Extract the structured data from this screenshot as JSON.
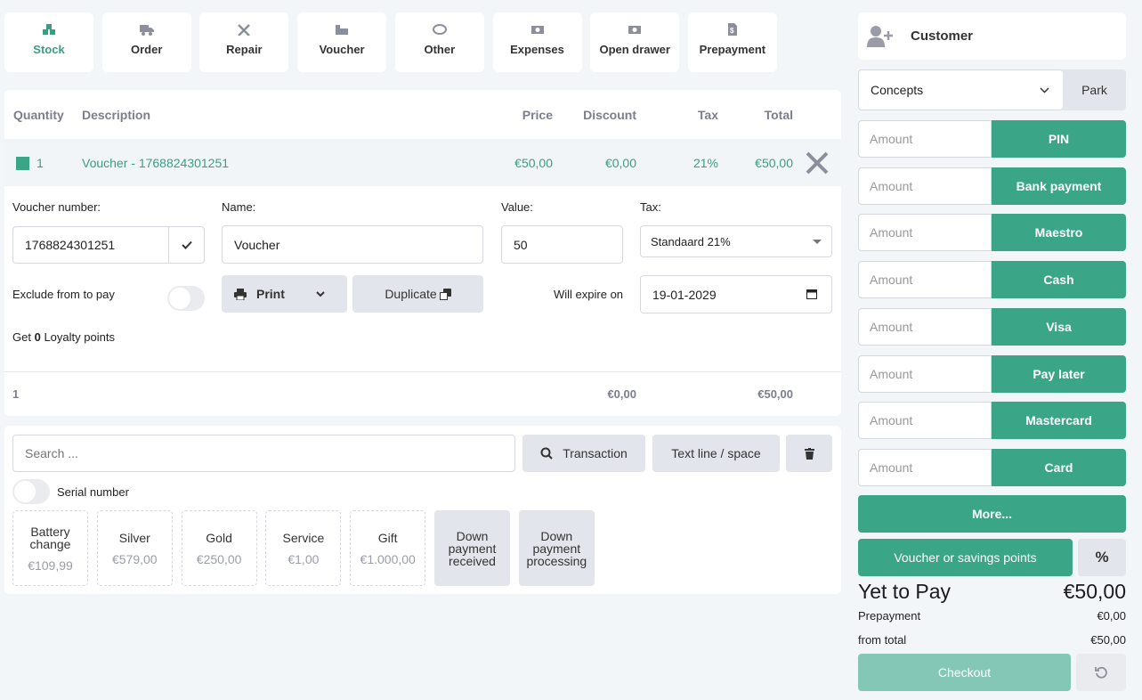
{
  "tabs": [
    {
      "label": "Stock",
      "icon": "boxes-icon"
    },
    {
      "label": "Order",
      "icon": "truck-icon"
    },
    {
      "label": "Repair",
      "icon": "tools-icon"
    },
    {
      "label": "Voucher",
      "icon": "voucher-icon"
    },
    {
      "label": "Other",
      "icon": "ring-icon"
    },
    {
      "label": "Expenses",
      "icon": "money-icon"
    },
    {
      "label": "Open drawer",
      "icon": "cash-drawer-icon"
    },
    {
      "label": "Prepayment",
      "icon": "invoice-icon"
    }
  ],
  "table": {
    "headers": {
      "quantity": "Quantity",
      "description": "Description",
      "price": "Price",
      "discount": "Discount",
      "tax": "Tax",
      "total": "Total"
    },
    "row": {
      "quantity": "1",
      "description": "Voucher - 1768824301251",
      "price": "€50,00",
      "discount": "€0,00",
      "tax": "21%",
      "total": "€50,00"
    },
    "totals": {
      "quantity": "1",
      "discount": "€0,00",
      "total": "€50,00"
    }
  },
  "form": {
    "voucher_label": "Voucher number:",
    "voucher_value": "1768824301251",
    "name_label": "Name:",
    "name_value": "Voucher",
    "value_label": "Value:",
    "value_value": "50",
    "tax_label": "Tax:",
    "tax_value": "Standaard 21%",
    "exclude_label": "Exclude from to pay",
    "print": "Print",
    "duplicate": "Duplicate",
    "expire_label": "Will expire on",
    "expire_value": "19-01-2029",
    "loyalty_pre": "Get",
    "loyalty_points": "0",
    "loyalty_post": "Loyalty points"
  },
  "search": {
    "placeholder": "Search ...",
    "transaction": "Transaction",
    "text_line": "Text line / space",
    "serial": "Serial number"
  },
  "quick": [
    {
      "name": "Battery change",
      "price": "€109,99"
    },
    {
      "name": "Silver",
      "price": "€579,00"
    },
    {
      "name": "Gold",
      "price": "€250,00"
    },
    {
      "name": "Service",
      "price": "€1,00"
    },
    {
      "name": "Gift",
      "price": "€1.000,00"
    },
    {
      "name": "Down payment received"
    },
    {
      "name": "Down payment processing"
    }
  ],
  "right": {
    "customer": "Customer",
    "concepts": "Concepts",
    "park": "Park",
    "amount_placeholder": "Amount",
    "payments": [
      "PIN",
      "Bank payment",
      "Maestro",
      "Cash",
      "Visa",
      "Pay later",
      "Mastercard",
      "Card"
    ],
    "more": "More...",
    "voucher": "Voucher or savings points",
    "percent": "%",
    "yet_label": "Yet to Pay",
    "yet_value": "€50,00",
    "prepay_label": "Prepayment",
    "prepay_value": "€0,00",
    "from_label": "from total",
    "from_value": "€50,00",
    "checkout": "Checkout"
  },
  "colors": {
    "accent": "#3ba588",
    "checkout": "#85c7b6"
  }
}
